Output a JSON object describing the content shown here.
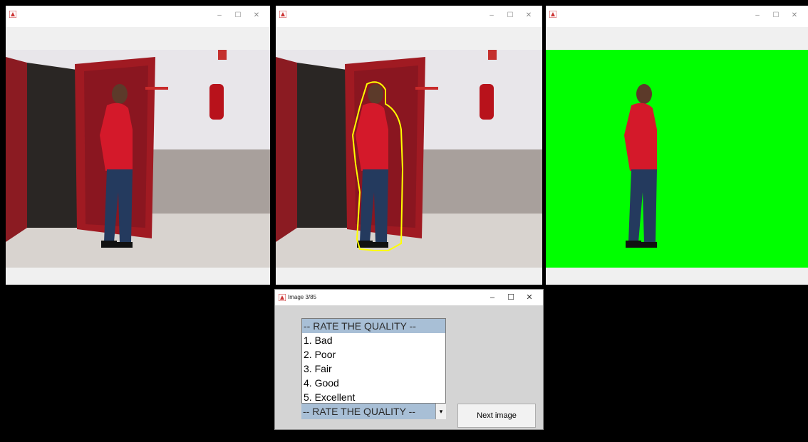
{
  "windows": [
    {
      "title": "",
      "controls": [
        "–",
        "☐",
        "✕"
      ]
    },
    {
      "title": "",
      "controls": [
        "–",
        "☐",
        "✕"
      ]
    },
    {
      "title": "",
      "controls": [
        "–",
        "☐",
        "✕"
      ]
    }
  ],
  "dialog": {
    "title": "Image 3/85",
    "controls": [
      "–",
      "☐",
      "✕"
    ],
    "options": [
      "-- RATE THE QUALITY --",
      "1. Bad",
      "2. Poor",
      "3. Fair",
      "4. Good",
      "5. Excellent"
    ],
    "selected": "-- RATE THE QUALITY --",
    "dropdown_arrow": "▾",
    "next_label": "Next image"
  },
  "colors": {
    "contour": "#ffff00",
    "green_screen": "#00ff00",
    "hoodie": "#d4192a"
  }
}
